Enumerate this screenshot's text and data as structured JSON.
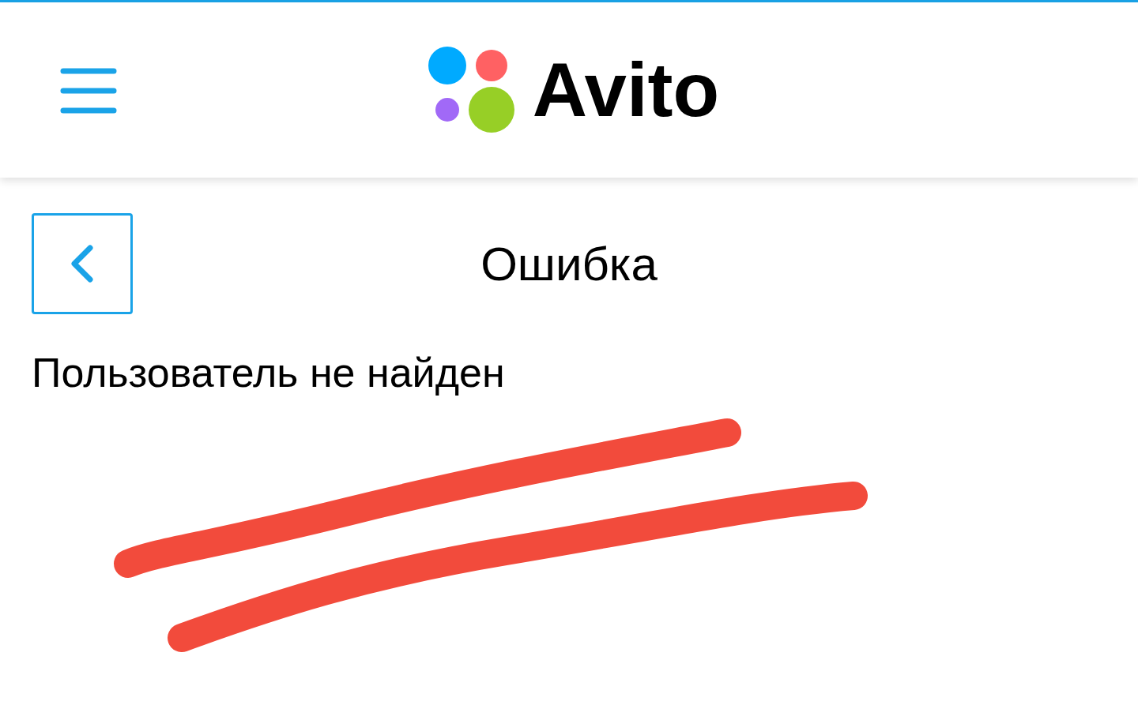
{
  "header": {
    "logo": "Avito"
  },
  "page": {
    "title": "Ошибка",
    "message": "Пользователь не найден"
  }
}
